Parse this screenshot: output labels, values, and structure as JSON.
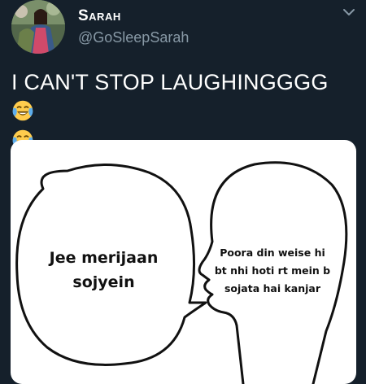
{
  "tweet": {
    "display_name": "Sarah",
    "handle": "@GoSleepSarah",
    "text": "I CAN'T STOP LAUGHINGGGG",
    "emojis": [
      "face-with-tears-of-joy-icon",
      "face-with-tears-of-joy-icon"
    ]
  },
  "meme": {
    "left_bubble_text": "Jee merijaan sojyein",
    "right_head_text": "Poora din weise hi bt nhi hoti rt mein b sojata hai kanjar"
  },
  "colors": {
    "background": "#15202b",
    "handle": "#8899a6",
    "text": "#ffffff"
  }
}
